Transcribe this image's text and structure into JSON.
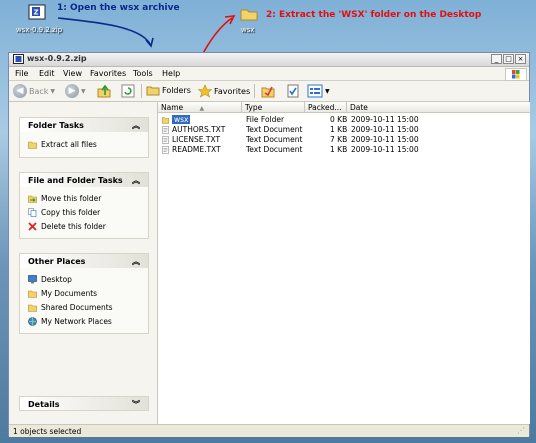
{
  "desktop": {
    "archive_label": "wsx-0.9.2.zip",
    "folder_label": "wsx"
  },
  "annotations": {
    "step1": "1: Open the wsx archive",
    "step2": "2: Extract the 'WSX' folder on the Desktop",
    "step1_color": "#0a2a8a",
    "step2_color": "#e01010"
  },
  "window": {
    "title": "wsx-0.9.2.zip",
    "menu": [
      "File",
      "Edit",
      "View",
      "Favorites",
      "Tools",
      "Help"
    ],
    "toolbar": {
      "back": "Back",
      "folders": "Folders",
      "favorites": "Favorites"
    }
  },
  "sidebar": {
    "folder_tasks": {
      "title": "Folder Tasks",
      "items": [
        "Extract all files"
      ]
    },
    "file_folder_tasks": {
      "title": "File and Folder Tasks",
      "items": [
        "Move this folder",
        "Copy this folder",
        "Delete this folder"
      ]
    },
    "other_places": {
      "title": "Other Places",
      "items": [
        "Desktop",
        "My Documents",
        "Shared Documents",
        "My Network Places"
      ]
    },
    "details": {
      "title": "Details"
    }
  },
  "files": {
    "columns": [
      "Name",
      "Type",
      "Packed...",
      "Date"
    ],
    "rows": [
      {
        "name": "wsx",
        "type": "File Folder",
        "packed": "0 KB",
        "date": "2009-10-11 15:00",
        "icon": "folder-icon"
      },
      {
        "name": "AUTHORS.TXT",
        "type": "Text Document",
        "packed": "1 KB",
        "date": "2009-10-11 15:00",
        "icon": "text-file-icon"
      },
      {
        "name": "LICENSE.TXT",
        "type": "Text Document",
        "packed": "7 KB",
        "date": "2009-10-11 15:00",
        "icon": "text-file-icon"
      },
      {
        "name": "README.TXT",
        "type": "Text Document",
        "packed": "1 KB",
        "date": "2009-10-11 15:00",
        "icon": "text-file-icon"
      }
    ]
  },
  "status": {
    "text": "1 objects selected"
  }
}
